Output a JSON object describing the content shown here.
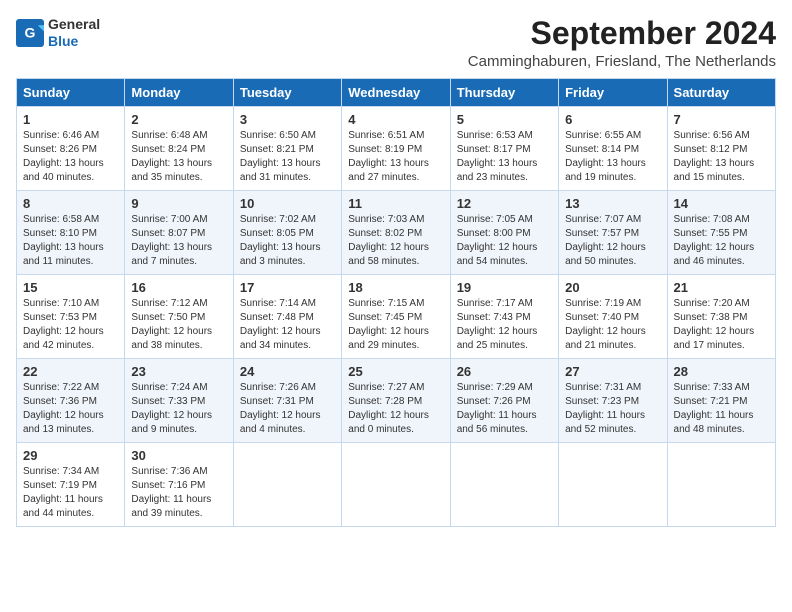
{
  "header": {
    "logo_line1": "General",
    "logo_line2": "Blue",
    "month_title": "September 2024",
    "subtitle": "Camminghaburen, Friesland, The Netherlands"
  },
  "weekdays": [
    "Sunday",
    "Monday",
    "Tuesday",
    "Wednesday",
    "Thursday",
    "Friday",
    "Saturday"
  ],
  "weeks": [
    [
      {
        "day": "1",
        "info": "Sunrise: 6:46 AM\nSunset: 8:26 PM\nDaylight: 13 hours\nand 40 minutes."
      },
      {
        "day": "2",
        "info": "Sunrise: 6:48 AM\nSunset: 8:24 PM\nDaylight: 13 hours\nand 35 minutes."
      },
      {
        "day": "3",
        "info": "Sunrise: 6:50 AM\nSunset: 8:21 PM\nDaylight: 13 hours\nand 31 minutes."
      },
      {
        "day": "4",
        "info": "Sunrise: 6:51 AM\nSunset: 8:19 PM\nDaylight: 13 hours\nand 27 minutes."
      },
      {
        "day": "5",
        "info": "Sunrise: 6:53 AM\nSunset: 8:17 PM\nDaylight: 13 hours\nand 23 minutes."
      },
      {
        "day": "6",
        "info": "Sunrise: 6:55 AM\nSunset: 8:14 PM\nDaylight: 13 hours\nand 19 minutes."
      },
      {
        "day": "7",
        "info": "Sunrise: 6:56 AM\nSunset: 8:12 PM\nDaylight: 13 hours\nand 15 minutes."
      }
    ],
    [
      {
        "day": "8",
        "info": "Sunrise: 6:58 AM\nSunset: 8:10 PM\nDaylight: 13 hours\nand 11 minutes."
      },
      {
        "day": "9",
        "info": "Sunrise: 7:00 AM\nSunset: 8:07 PM\nDaylight: 13 hours\nand 7 minutes."
      },
      {
        "day": "10",
        "info": "Sunrise: 7:02 AM\nSunset: 8:05 PM\nDaylight: 13 hours\nand 3 minutes."
      },
      {
        "day": "11",
        "info": "Sunrise: 7:03 AM\nSunset: 8:02 PM\nDaylight: 12 hours\nand 58 minutes."
      },
      {
        "day": "12",
        "info": "Sunrise: 7:05 AM\nSunset: 8:00 PM\nDaylight: 12 hours\nand 54 minutes."
      },
      {
        "day": "13",
        "info": "Sunrise: 7:07 AM\nSunset: 7:57 PM\nDaylight: 12 hours\nand 50 minutes."
      },
      {
        "day": "14",
        "info": "Sunrise: 7:08 AM\nSunset: 7:55 PM\nDaylight: 12 hours\nand 46 minutes."
      }
    ],
    [
      {
        "day": "15",
        "info": "Sunrise: 7:10 AM\nSunset: 7:53 PM\nDaylight: 12 hours\nand 42 minutes."
      },
      {
        "day": "16",
        "info": "Sunrise: 7:12 AM\nSunset: 7:50 PM\nDaylight: 12 hours\nand 38 minutes."
      },
      {
        "day": "17",
        "info": "Sunrise: 7:14 AM\nSunset: 7:48 PM\nDaylight: 12 hours\nand 34 minutes."
      },
      {
        "day": "18",
        "info": "Sunrise: 7:15 AM\nSunset: 7:45 PM\nDaylight: 12 hours\nand 29 minutes."
      },
      {
        "day": "19",
        "info": "Sunrise: 7:17 AM\nSunset: 7:43 PM\nDaylight: 12 hours\nand 25 minutes."
      },
      {
        "day": "20",
        "info": "Sunrise: 7:19 AM\nSunset: 7:40 PM\nDaylight: 12 hours\nand 21 minutes."
      },
      {
        "day": "21",
        "info": "Sunrise: 7:20 AM\nSunset: 7:38 PM\nDaylight: 12 hours\nand 17 minutes."
      }
    ],
    [
      {
        "day": "22",
        "info": "Sunrise: 7:22 AM\nSunset: 7:36 PM\nDaylight: 12 hours\nand 13 minutes."
      },
      {
        "day": "23",
        "info": "Sunrise: 7:24 AM\nSunset: 7:33 PM\nDaylight: 12 hours\nand 9 minutes."
      },
      {
        "day": "24",
        "info": "Sunrise: 7:26 AM\nSunset: 7:31 PM\nDaylight: 12 hours\nand 4 minutes."
      },
      {
        "day": "25",
        "info": "Sunrise: 7:27 AM\nSunset: 7:28 PM\nDaylight: 12 hours\nand 0 minutes."
      },
      {
        "day": "26",
        "info": "Sunrise: 7:29 AM\nSunset: 7:26 PM\nDaylight: 11 hours\nand 56 minutes."
      },
      {
        "day": "27",
        "info": "Sunrise: 7:31 AM\nSunset: 7:23 PM\nDaylight: 11 hours\nand 52 minutes."
      },
      {
        "day": "28",
        "info": "Sunrise: 7:33 AM\nSunset: 7:21 PM\nDaylight: 11 hours\nand 48 minutes."
      }
    ],
    [
      {
        "day": "29",
        "info": "Sunrise: 7:34 AM\nSunset: 7:19 PM\nDaylight: 11 hours\nand 44 minutes."
      },
      {
        "day": "30",
        "info": "Sunrise: 7:36 AM\nSunset: 7:16 PM\nDaylight: 11 hours\nand 39 minutes."
      },
      null,
      null,
      null,
      null,
      null
    ]
  ]
}
